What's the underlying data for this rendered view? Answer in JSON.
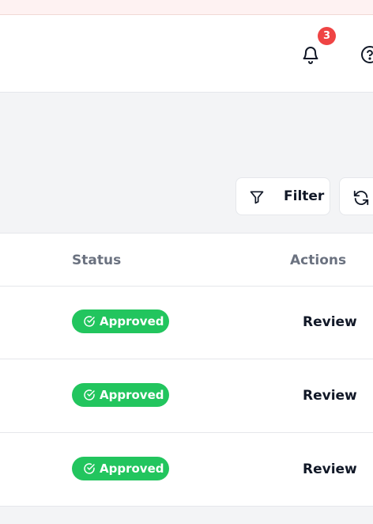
{
  "header": {
    "notification_count": "3"
  },
  "toolbar": {
    "filter_label": "Filter"
  },
  "table": {
    "columns": [
      "Status",
      "Actions"
    ],
    "rows": [
      {
        "status": "Approved",
        "action": "Review"
      },
      {
        "status": "Approved",
        "action": "Review"
      },
      {
        "status": "Approved",
        "action": "Review"
      }
    ]
  },
  "colors": {
    "approved": "#22c55e",
    "badge": "#ef4444"
  },
  "icons": [
    "bell-icon",
    "help-circle-icon",
    "filter-icon",
    "refresh-icon",
    "check-circle-icon"
  ]
}
